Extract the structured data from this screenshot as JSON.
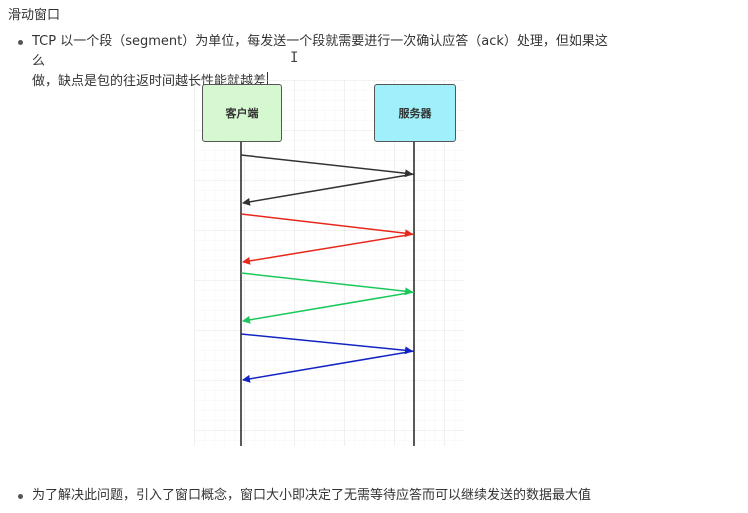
{
  "heading": "滑动窗口",
  "bullet1": {
    "line1": "TCP 以一个段（segment）为单位，每发送一个段就需要进行一次确认应答（ack）处理，但如果这么",
    "line2": "做，缺点是包的往返时间越长性能就越差"
  },
  "diagram": {
    "client_label": "客户端",
    "server_label": "服务器",
    "colors": {
      "pair1": "#333333",
      "pair2": "#e8271b",
      "pair3": "#18c95a",
      "pair4": "#1324c2",
      "client_box": "#d6f8d0",
      "server_box": "#9ff0fb",
      "grid": "#e4e4e4"
    }
  },
  "bullet2": {
    "text": "为了解决此问题，引入了窗口概念，窗口大小即决定了无需等待应答而可以继续发送的数据最大值"
  }
}
